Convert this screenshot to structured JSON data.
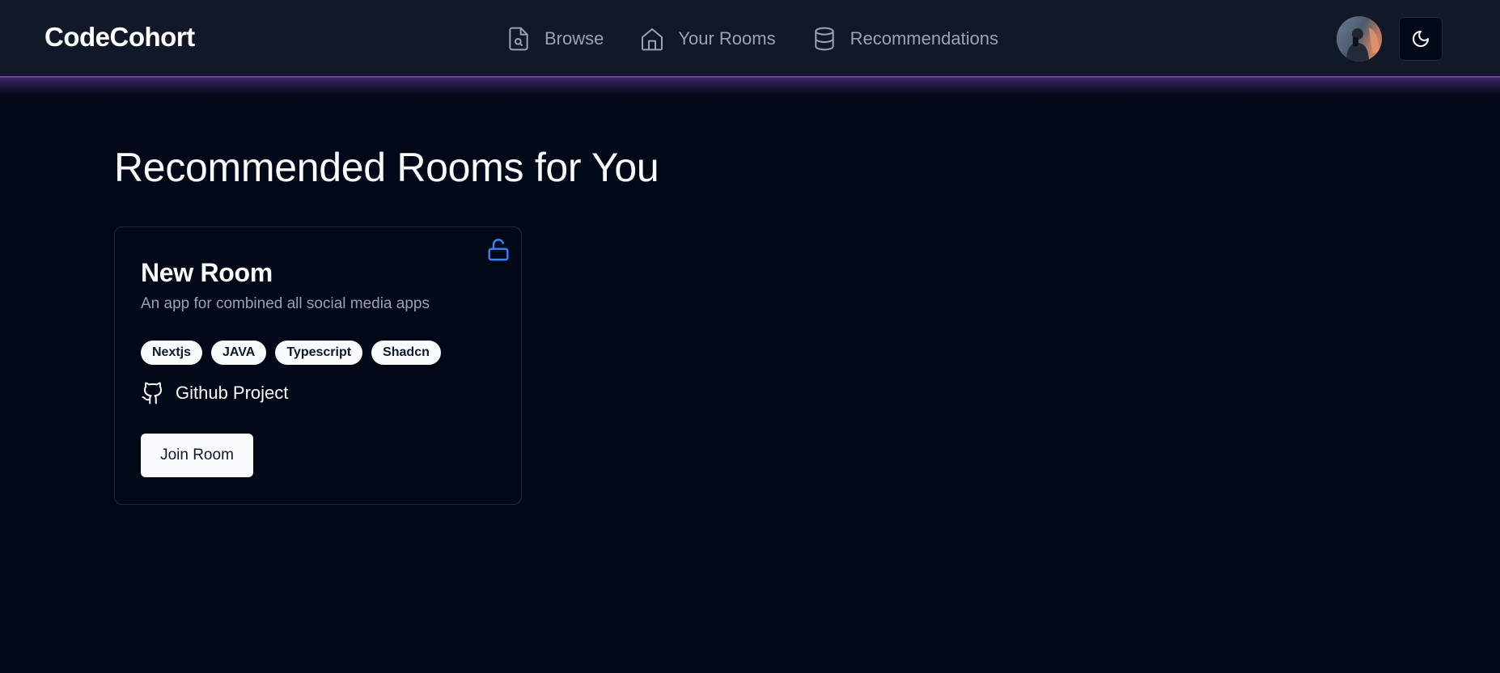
{
  "app": {
    "logo": "CodeCohort"
  },
  "nav": {
    "items": [
      {
        "label": "Browse",
        "icon": "file-search-icon"
      },
      {
        "label": "Your Rooms",
        "icon": "home-icon"
      },
      {
        "label": "Recommendations",
        "icon": "database-icon"
      }
    ]
  },
  "header": {
    "avatar_icon": "user-avatar",
    "theme_toggle_icon": "moon-icon"
  },
  "main": {
    "title": "Recommended Rooms for You",
    "rooms": [
      {
        "name": "New Room",
        "description": "An app for combined all social media apps",
        "tags": [
          "Nextjs",
          "JAVA",
          "Typescript",
          "Shadcn"
        ],
        "github_label": "Github Project",
        "join_label": "Join Room",
        "lock_icon": "unlock-icon"
      }
    ]
  },
  "colors": {
    "background": "#020817",
    "header": "#111827",
    "accent_border": "#6b3fa0",
    "lock_icon": "#3b82f6",
    "muted_text": "#94a3b8"
  }
}
